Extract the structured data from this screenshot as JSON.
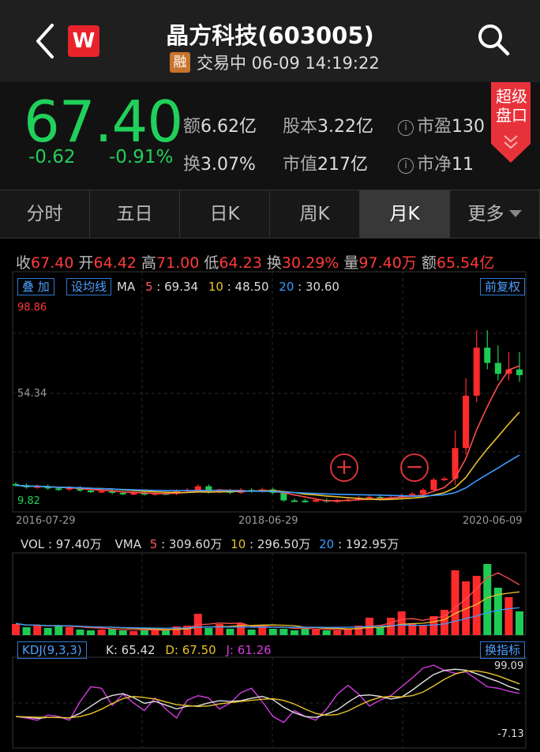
{
  "header": {
    "logo_text": "W",
    "title": "晶方科技(603005)",
    "margin_badge": "融",
    "status": "交易中 06-09 14:19:22"
  },
  "quote": {
    "price": "67.40",
    "change": "-0.62",
    "change_pct": "-0.91%",
    "amount_label": "额",
    "amount": "6.62亿",
    "turnover_label": "换",
    "turnover": "3.07%",
    "shares_label": "股本",
    "shares": "3.22亿",
    "mktcap_label": "市值",
    "mktcap": "217亿",
    "pe_label": "市盈",
    "pe": "130",
    "pb_label": "市净",
    "pb": "11",
    "super_panel": "超级盘口",
    "colors": {
      "down": "#20d05a",
      "up": "#ff3b3b"
    }
  },
  "tabs": [
    {
      "label": "分时"
    },
    {
      "label": "五日"
    },
    {
      "label": "日K"
    },
    {
      "label": "周K"
    },
    {
      "label": "月K",
      "active": true
    },
    {
      "label": "更多"
    }
  ],
  "kline": {
    "ohlc": {
      "close_label": "收",
      "close": "67.40",
      "open_label": "开",
      "open": "64.42",
      "high_label": "高",
      "high": "71.00",
      "low_label": "低",
      "low": "64.23",
      "turn_label": "换",
      "turn": "30.29%",
      "vol_label": "量",
      "vol": "97.40万",
      "amt_label": "额",
      "amt": "65.54亿"
    },
    "overlay_button": "叠 加",
    "set_ma_button": "设均线",
    "restore_button": "前复权",
    "ma": {
      "label": "MA",
      "ma5_key": "5",
      "ma5": "69.34",
      "ma10_key": "10",
      "ma10": "48.50",
      "ma20_key": "20",
      "ma20": "30.60"
    },
    "y_max": "98.86",
    "y_mid": "54.34",
    "y_min": "9.82",
    "dates": [
      "2016-07-29",
      "2018-06-29",
      "2020-06-09"
    ],
    "zoom_in": "+",
    "zoom_out": "−"
  },
  "volume": {
    "label": "VOL",
    "value": "97.40万",
    "vma_label": "VMA",
    "v5_key": "5",
    "v5": "309.60万",
    "v10_key": "10",
    "v10": "296.50万",
    "v20_key": "20",
    "v20": "192.95万"
  },
  "kdj": {
    "label": "KDJ(9,3,3)",
    "k": "K: 65.42",
    "d": "D: 67.50",
    "j": "J: 61.26",
    "switch_button": "换指标",
    "max": "99.09",
    "min": "-7.13"
  }
}
